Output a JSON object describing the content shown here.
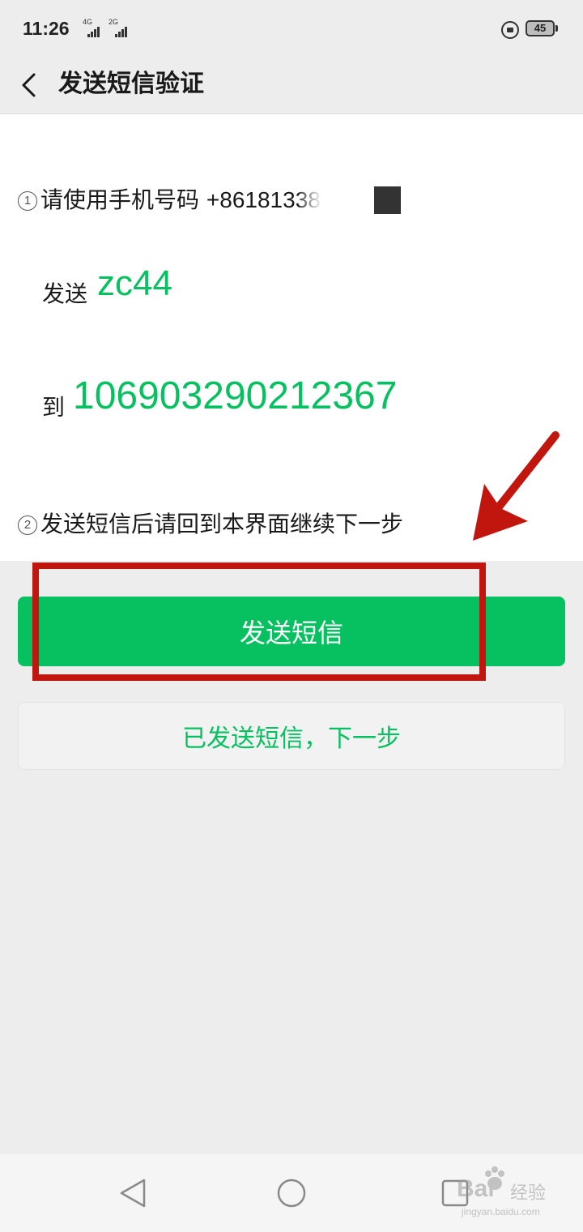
{
  "status_bar": {
    "time": "11:26",
    "signal_1_label": "4G",
    "signal_2_label": "2G",
    "battery": "45"
  },
  "header": {
    "title": "发送短信验证"
  },
  "step1": {
    "number": "①",
    "prefix": "请使用手机号码 ",
    "phone": "+86181338",
    "send_label": "发送",
    "code": "zc44",
    "to_label": "到",
    "target_number": "106903290212367"
  },
  "step2": {
    "number": "②",
    "text": "发送短信后请回到本界面继续下一步"
  },
  "buttons": {
    "send_sms": "发送短信",
    "sent_next": "已发送短信，下一步"
  },
  "watermark": {
    "brand": "Bai",
    "brand_suffix": "经验",
    "url": "jingyan.baidu.com"
  },
  "colors": {
    "accent": "#07c160",
    "annotation": "#c0160e"
  },
  "icons": {
    "back": "chevron-left-icon",
    "lock": "rotation-lock-icon",
    "nav_back": "triangle-back-icon",
    "nav_home": "circle-home-icon",
    "nav_recent": "square-recent-icon"
  }
}
